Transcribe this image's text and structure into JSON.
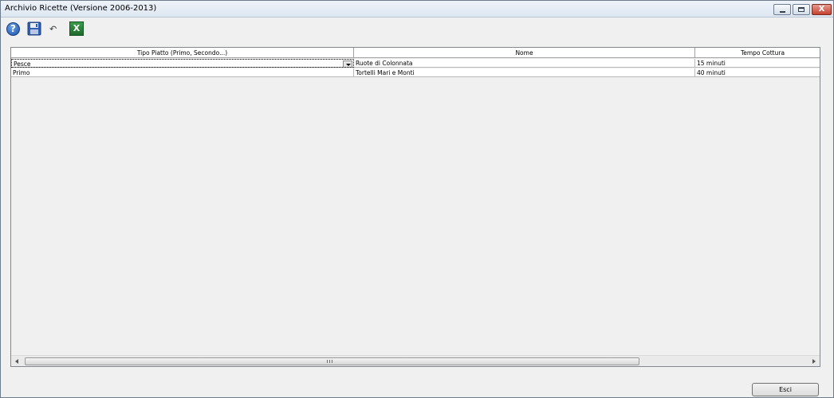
{
  "window": {
    "title": "Archivio Ricette (Versione 2006-2013)",
    "buttons": {
      "close_glyph": "X"
    }
  },
  "toolbar": {
    "help_glyph": "?",
    "undo_glyph": "↶",
    "excel_glyph": "X"
  },
  "grid": {
    "columns": [
      "Tipo Piatto (Primo, Secondo...)",
      "Nome",
      "Tempo Cottura"
    ],
    "rows": [
      [
        "Pesce",
        "Ruote di Colonnata",
        "15 minuti"
      ],
      [
        "Primo",
        "Tortelli Mari e Monti",
        "40 minuti"
      ]
    ],
    "scroll_grip": "III"
  },
  "footer": {
    "exit_label": "Esci"
  },
  "colors": {
    "title_bg": "#dde6f1",
    "close_button": "#c5402f",
    "excel": "#1e6a2d",
    "help": "#1e4fa8"
  }
}
